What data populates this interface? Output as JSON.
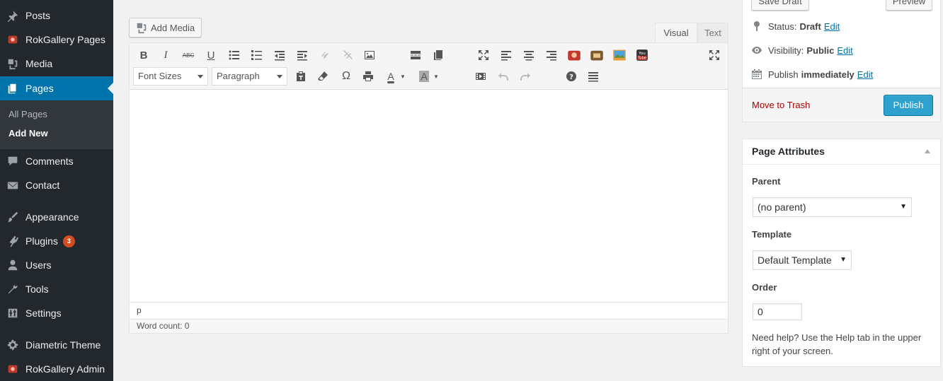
{
  "sidebar": {
    "items": [
      {
        "label": "Posts",
        "icon": "pushpin-icon"
      },
      {
        "label": "RokGallery Pages",
        "icon": "rokgallery-icon"
      },
      {
        "label": "Media",
        "icon": "media-icon"
      },
      {
        "label": "Pages",
        "icon": "pages-icon"
      },
      {
        "label": "Comments",
        "icon": "comment-icon"
      },
      {
        "label": "Contact",
        "icon": "envelope-icon"
      },
      {
        "label": "Appearance",
        "icon": "paintbrush-icon"
      },
      {
        "label": "Plugins",
        "icon": "plugin-icon",
        "badge": "3"
      },
      {
        "label": "Users",
        "icon": "user-icon"
      },
      {
        "label": "Tools",
        "icon": "wrench-icon"
      },
      {
        "label": "Settings",
        "icon": "settings-icon"
      },
      {
        "label": "Diametric Theme",
        "icon": "gear-icon"
      },
      {
        "label": "RokGallery Admin",
        "icon": "rokgallery-icon"
      }
    ],
    "submenu": {
      "all_pages": "All Pages",
      "add_new": "Add New"
    },
    "accent_color": "#0073aa"
  },
  "editor": {
    "add_media_label": "Add Media",
    "tabs": {
      "visual": "Visual",
      "text": "Text"
    },
    "font_sizes_label": "Font Sizes",
    "format_label": "Paragraph",
    "path": "p",
    "word_count": "Word count: 0"
  },
  "publish": {
    "save_draft_label": "Save Draft",
    "preview_label": "Preview",
    "status_label": "Status:",
    "status_value": "Draft",
    "visibility_label": "Visibility:",
    "visibility_value": "Public",
    "publish_label": "Publish",
    "publish_value": "immediately",
    "edit_label": "Edit",
    "trash_label": "Move to Trash",
    "publish_button": "Publish",
    "publish_color": "#2ea2cc"
  },
  "page_attributes": {
    "title": "Page Attributes",
    "parent_label": "Parent",
    "parent_value": "(no parent)",
    "template_label": "Template",
    "template_value": "Default Template",
    "order_label": "Order",
    "order_value": "0",
    "help_text": "Need help? Use the Help tab in the upper right of your screen."
  }
}
